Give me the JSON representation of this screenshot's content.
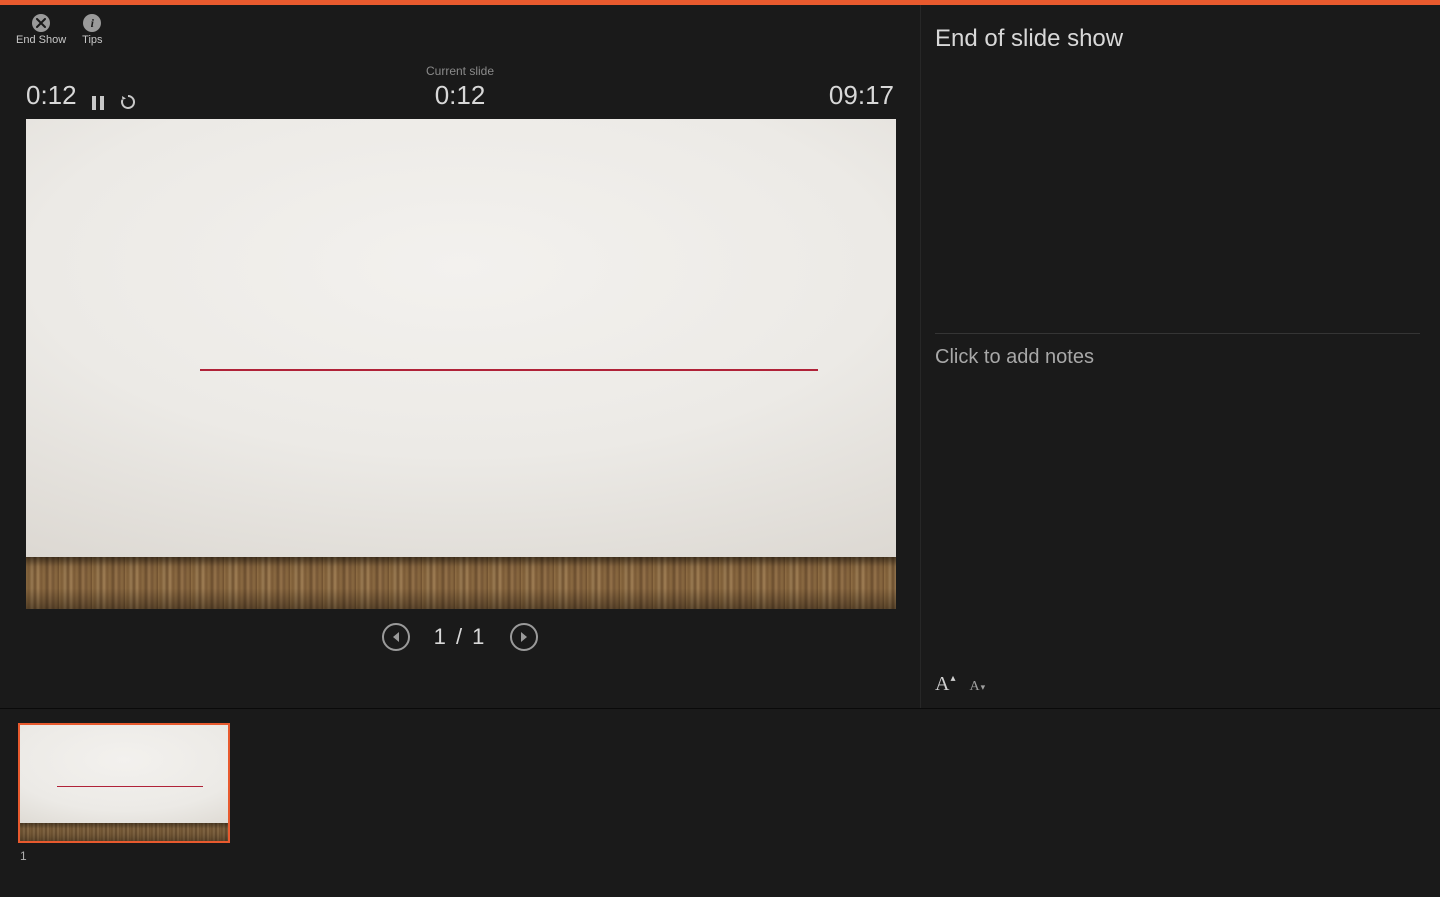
{
  "toolbar": {
    "end_show_label": "End Show",
    "tips_label": "Tips"
  },
  "timers": {
    "elapsed": "0:12",
    "current_slide_label": "Current slide",
    "current_slide_time": "0:12",
    "clock": "09:17"
  },
  "navigation": {
    "slide_counter": "1 / 1"
  },
  "next_panel": {
    "title": "End of slide show",
    "notes_placeholder": "Click to add notes"
  },
  "thumbnails": [
    {
      "index": "1"
    }
  ],
  "colors": {
    "accent": "#e85a2e",
    "redline": "#b02238"
  }
}
